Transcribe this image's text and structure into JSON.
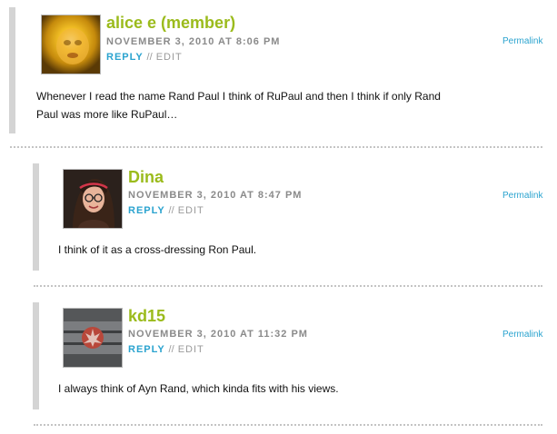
{
  "comments": [
    {
      "author": "alice e (member)",
      "date": "NOVEMBER 3, 2010 AT 8:06 PM",
      "reply_label": "REPLY",
      "separator": "//",
      "edit_label": "EDIT",
      "permalink_label": "Permalink",
      "text": "Whenever I read the name Rand Paul I think of RuPaul and then I think if only Rand Paul was more like RuPaul…",
      "avatar_icon": "blurry-face-avatar"
    },
    {
      "author": "Dina",
      "date": "NOVEMBER 3, 2010 AT 8:47 PM",
      "reply_label": "REPLY",
      "separator": "//",
      "edit_label": "EDIT",
      "permalink_label": "Permalink",
      "text": "I think of it as a cross-dressing Ron Paul.",
      "avatar_icon": "woman-with-glasses-avatar"
    },
    {
      "author": "kd15",
      "date": "NOVEMBER 3, 2010 AT 11:32 PM",
      "reply_label": "REPLY",
      "separator": "//",
      "edit_label": "EDIT",
      "permalink_label": "Permalink",
      "text": "I always think of Ayn Rand, which kinda fits with his views.",
      "avatar_icon": "rebel-alliance-emblem-avatar"
    }
  ],
  "colors": {
    "author": "#9bbb1c",
    "link": "#2aa3cf",
    "meta": "#8a8a8a",
    "thread_bar": "#d4d4d4"
  }
}
